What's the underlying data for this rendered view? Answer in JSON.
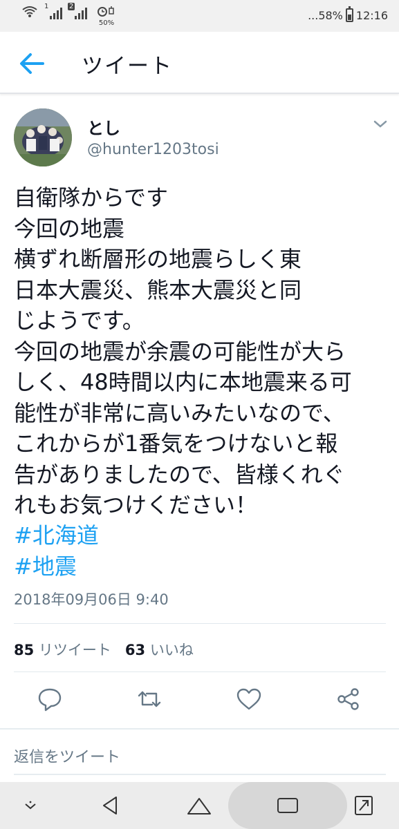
{
  "status_bar": {
    "sim1_label": "1",
    "sim2_label": "2",
    "battery_saver_pct": "50%",
    "battery_text": "...58%",
    "battery_level": 0.58,
    "time": "12:16"
  },
  "header": {
    "title": "ツイート",
    "back_icon": "arrow-left-icon"
  },
  "tweet": {
    "user_name": "とし",
    "user_handle": "@hunter1203tosi",
    "body": "自衛隊からです\n今回の地震\n横ずれ断層形の地震らしく東\n日本大震災、熊本大震災と同\nじようです。\n今回の地震が余震の可能性が大ら\nしく、48時間以内に本地震来る可\n能性が非常に高いみたいなので、\nこれからが1番気をつけないと報\n告がありましたので、皆様くれぐ\nれもお気つけください！",
    "hashtags": [
      "#北海道",
      "#地震"
    ],
    "timestamp": "2018年09月06日 9:40",
    "retweet_count": "85",
    "retweet_label": "リツイート",
    "like_count": "63",
    "like_label": "いいね"
  },
  "actions": [
    "reply-icon",
    "retweet-icon",
    "like-icon",
    "share-icon"
  ],
  "reply_bar": {
    "placeholder": "返信をツイート"
  },
  "nav_bar": [
    "notification-down-icon",
    "back-triangle-icon",
    "home-icon",
    "recents-icon",
    "expand-icon"
  ],
  "colors": {
    "accent": "#1da1f2",
    "text": "#141823",
    "secondary": "#657786",
    "status_bar_bg": "#f1f1f1",
    "nav_bar_bg": "#ececec"
  }
}
